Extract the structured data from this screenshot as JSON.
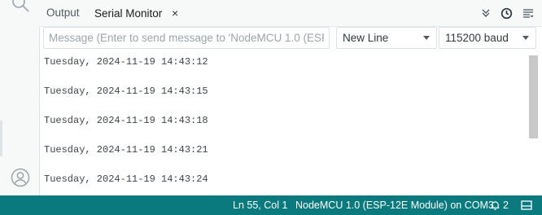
{
  "tabs": [
    {
      "label": "Output",
      "active": false
    },
    {
      "label": "Serial Monitor",
      "active": true
    }
  ],
  "tab_close_symbol": "×",
  "tab_actions": [
    "chevrons-down-icon",
    "clock-icon",
    "list-filter-icon"
  ],
  "toolbar": {
    "message_placeholder": "Message (Enter to send message to 'NodeMCU 1.0 (ESP-...",
    "line_ending": "New Line",
    "baud_rate": "115200 baud"
  },
  "serial_output": {
    "lines": [
      "Tuesday, 2024-11-19 14:43:12",
      "Tuesday, 2024-11-19 14:43:15",
      "Tuesday, 2024-11-19 14:43:18",
      "Tuesday, 2024-11-19 14:43:21",
      "Tuesday, 2024-11-19 14:43:24"
    ]
  },
  "status_bar": {
    "cursor_position": "Ln 55, Col 1",
    "board": "NodeMCU 1.0 (ESP-12E Module) on COM3",
    "notifications_count": "2",
    "background_color": "#0b7a7e"
  },
  "colors": {
    "accent": "#0b7a7e",
    "panel_bg": "#f7f9f9"
  }
}
